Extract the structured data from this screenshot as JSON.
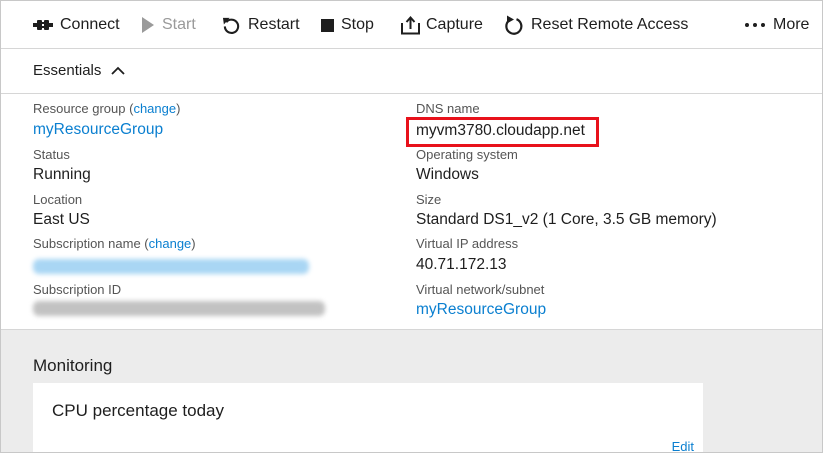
{
  "toolbar": {
    "connect": "Connect",
    "start": "Start",
    "restart": "Restart",
    "stop": "Stop",
    "capture": "Capture",
    "reset_remote_access": "Reset Remote Access",
    "more": "More"
  },
  "essentials": {
    "title": "Essentials",
    "left": {
      "resource_group_label": "Resource group",
      "resource_group_change": "change",
      "resource_group_value": "myResourceGroup",
      "status_label": "Status",
      "status_value": "Running",
      "location_label": "Location",
      "location_value": "East US",
      "subscription_name_label": "Subscription name",
      "subscription_name_change": "change",
      "subscription_id_label": "Subscription ID"
    },
    "right": {
      "dns_label": "DNS name",
      "dns_value": "myvm3780.cloudapp.net",
      "os_label": "Operating system",
      "os_value": "Windows",
      "size_label": "Size",
      "size_value": "Standard DS1_v2 (1 Core, 3.5 GB memory)",
      "vip_label": "Virtual IP address",
      "vip_value": "40.71.172.13",
      "vnet_label": "Virtual network/subnet",
      "vnet_value": "myResourceGroup"
    }
  },
  "monitoring": {
    "title": "Monitoring",
    "tile_title": "CPU percentage today",
    "edit": "Edit"
  },
  "colors": {
    "link": "#0a7fd0",
    "highlight": "#e8111b",
    "monitoring_bg": "#ececec"
  }
}
